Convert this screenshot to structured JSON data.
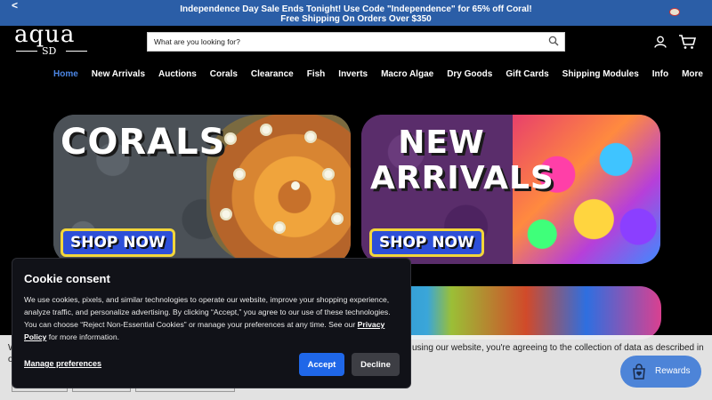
{
  "announcement": {
    "prev": "<",
    "next": ">",
    "line1": "Independence Day Sale Ends Tonight! Use Code \"Independence\" for 65% off Coral!",
    "line2": "Free Shipping On Orders Over $350"
  },
  "logo": {
    "top": "aqua",
    "bottom": "SD"
  },
  "search": {
    "placeholder": "What are you looking for?"
  },
  "nav": {
    "items": [
      "Home",
      "New Arrivals",
      "Auctions",
      "Corals",
      "Clearance",
      "Fish",
      "Inverts",
      "Macro Algae",
      "Dry Goods",
      "Gift Cards",
      "Shipping Modules",
      "Info",
      "More"
    ],
    "active": "Home"
  },
  "banners": {
    "corals": {
      "title": "CORALS",
      "cta": "SHOP NOW"
    },
    "new_arrivals": {
      "title_line1": "NEW",
      "title_line2": "ARRIVALS",
      "cta": "SHOP NOW"
    }
  },
  "gdpr_bar": {
    "partial_text": "using our website, you're agreeing to the collection of data as described in",
    "left_fragment_1": "W",
    "left_fragment_2": "o"
  },
  "cookie": {
    "title": "Cookie consent",
    "body_before": "We use cookies, pixels, and similar technologies to operate our website, improve your shopping experience, analyze traffic, and personalize advertising. By clicking “Accept,” you agree to our use of these technologies. You can choose “Reject Non-Essential Cookies” or manage your preferences at any time. See our ",
    "policy_link": "Privacy Policy",
    "body_after": " for more information.",
    "manage": "Manage preferences",
    "accept": "Accept",
    "decline": "Decline"
  },
  "rewards": {
    "label": "Rewards"
  },
  "colors": {
    "accent": "#2b5ea7",
    "nav_active": "#4c86e4",
    "accept": "#1f67e8",
    "rewards": "#4d84d8"
  }
}
